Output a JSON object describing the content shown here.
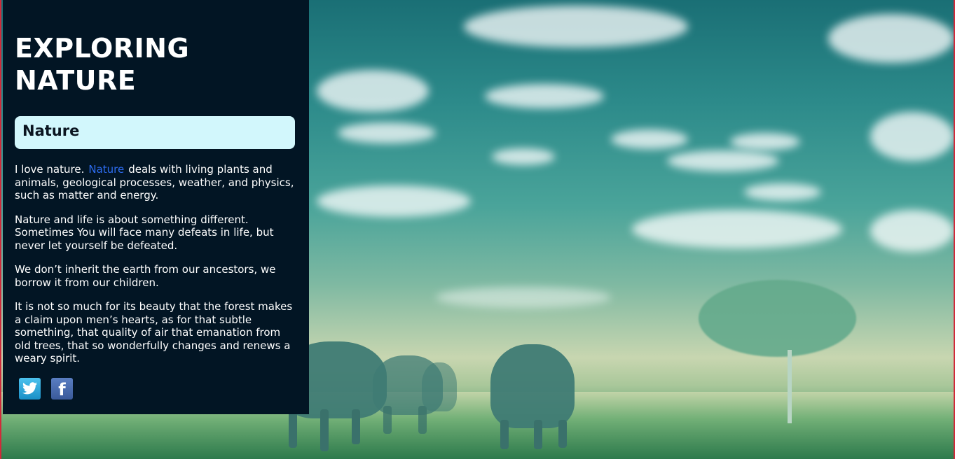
{
  "page": {
    "title": "EXPLORING NATURE",
    "section_heading": "Nature",
    "intro_before_link": "I love nature.",
    "intro_link": "Nature",
    "intro_after_link": "deals with living plants and animals, geological processes, weather, and physics, such as matter and energy.",
    "paragraphs": [
      "Nature and life is about something different. Sometimes You will face many defeats in life, but never let yourself be defeated.",
      "We don’t inherit the earth from our ancestors, we borrow it from our children.",
      "It is not so much for its beauty that the forest makes a claim upon men’s hearts, as for that subtle something, that quality of air that emanation from old trees, that so wonderfully changes and renews a weary spirit."
    ]
  },
  "social": {
    "icons": [
      "twitter-icon",
      "facebook-icon"
    ],
    "facebook_glyph": "f"
  },
  "colors": {
    "panel_bg": "#021524",
    "heading_box_bg": "#d2f7fc",
    "link": "#2d6cf0",
    "border": "#d12a3a"
  }
}
